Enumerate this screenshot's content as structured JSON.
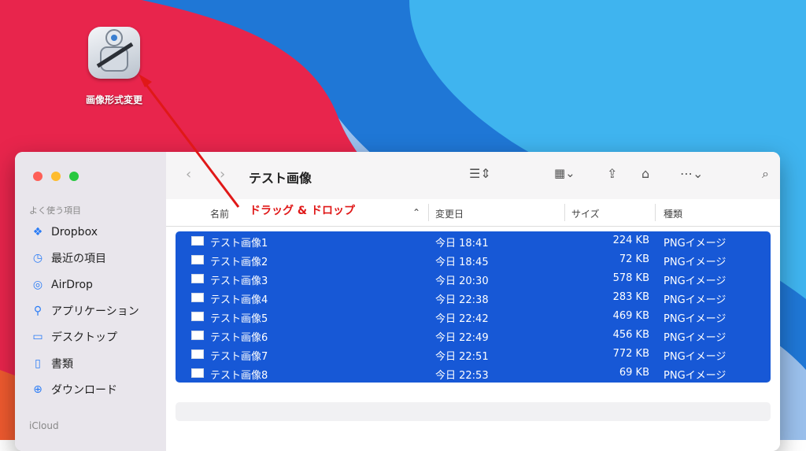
{
  "desktop": {
    "app_label": "画像形式変更"
  },
  "window": {
    "title": "テスト画像",
    "sidebar": {
      "favorites_header": "よく使う項目",
      "items": [
        {
          "label": "Dropbox",
          "icon": "dropbox-icon"
        },
        {
          "label": "最近の項目",
          "icon": "clock-icon"
        },
        {
          "label": "AirDrop",
          "icon": "airdrop-icon"
        },
        {
          "label": "アプリケーション",
          "icon": "applications-icon"
        },
        {
          "label": "デスクトップ",
          "icon": "desktop-icon"
        },
        {
          "label": "書類",
          "icon": "document-icon"
        },
        {
          "label": "ダウンロード",
          "icon": "download-icon"
        }
      ],
      "icloud_header": "iCloud"
    },
    "columns": {
      "name": "名前",
      "date": "変更日",
      "size": "サイズ",
      "kind": "種類"
    },
    "annotation": "ドラッグ & ドロップ",
    "files": [
      {
        "name": "テスト画像1",
        "date": "今日 18:41",
        "size": "224 KB",
        "kind": "PNGイメージ"
      },
      {
        "name": "テスト画像2",
        "date": "今日 18:45",
        "size": "72 KB",
        "kind": "PNGイメージ"
      },
      {
        "name": "テスト画像3",
        "date": "今日 20:30",
        "size": "578 KB",
        "kind": "PNGイメージ"
      },
      {
        "name": "テスト画像4",
        "date": "今日 22:38",
        "size": "283 KB",
        "kind": "PNGイメージ"
      },
      {
        "name": "テスト画像5",
        "date": "今日 22:42",
        "size": "469 KB",
        "kind": "PNGイメージ"
      },
      {
        "name": "テスト画像6",
        "date": "今日 22:49",
        "size": "456 KB",
        "kind": "PNGイメージ"
      },
      {
        "name": "テスト画像7",
        "date": "今日 22:51",
        "size": "772 KB",
        "kind": "PNGイメージ"
      },
      {
        "name": "テスト画像8",
        "date": "今日 22:53",
        "size": "69 KB",
        "kind": "PNGイメージ"
      }
    ]
  },
  "colors": {
    "selection": "#1758d6",
    "annotation": "#e01818"
  }
}
